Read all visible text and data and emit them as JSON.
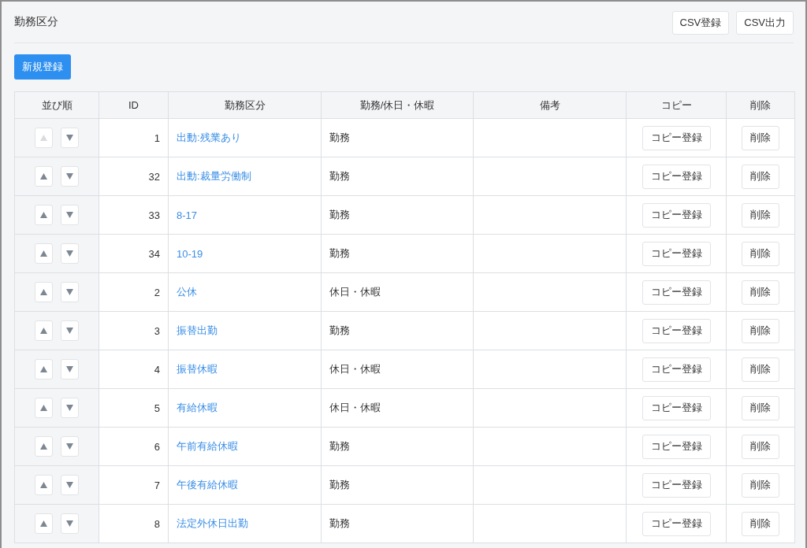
{
  "header": {
    "title": "勤務区分",
    "buttons": [
      "CSV登録",
      "CSV出力"
    ]
  },
  "new_button": "新規登録",
  "table": {
    "columns": [
      "並び順",
      "ID",
      "勤務区分",
      "勤務/休日・休暇",
      "備考",
      "コピー",
      "削除"
    ],
    "rows": [
      {
        "id": "1",
        "name": "出動:残業あり",
        "type": "勤務",
        "up_disabled": true,
        "down_disabled": false,
        "copy": "コピー登録",
        "delete": "削除"
      },
      {
        "id": "32",
        "name": "出動:裁量労働制",
        "type": "勤務",
        "up_disabled": false,
        "down_disabled": false,
        "copy": "コピー登録",
        "delete": "削除"
      },
      {
        "id": "33",
        "name": "8-17",
        "type": "勤務",
        "up_disabled": false,
        "down_disabled": false,
        "copy": "コピー登録",
        "delete": "削除"
      },
      {
        "id": "34",
        "name": "10-19",
        "type": "勤務",
        "up_disabled": false,
        "down_disabled": false,
        "copy": "コピー登録",
        "delete": "削除"
      },
      {
        "id": "2",
        "name": "公休",
        "type": "休日・休暇",
        "up_disabled": false,
        "down_disabled": false,
        "copy": "コピー登録",
        "delete": "削除"
      },
      {
        "id": "3",
        "name": "振替出勤",
        "type": "勤務",
        "up_disabled": false,
        "down_disabled": false,
        "copy": "コピー登録",
        "delete": "削除"
      },
      {
        "id": "4",
        "name": "振替休暇",
        "type": "休日・休暇",
        "up_disabled": false,
        "down_disabled": false,
        "copy": "コピー登録",
        "delete": "削除"
      },
      {
        "id": "5",
        "name": "有給休暇",
        "type": "休日・休暇",
        "up_disabled": false,
        "down_disabled": false,
        "copy": "コピー登録",
        "delete": "削除"
      },
      {
        "id": "6",
        "name": "午前有給休暇",
        "type": "勤務",
        "up_disabled": false,
        "down_disabled": false,
        "copy": "コピー登録",
        "delete": "削除"
      },
      {
        "id": "7",
        "name": "午後有給休暇",
        "type": "勤務",
        "up_disabled": false,
        "down_disabled": false,
        "copy": "コピー登録",
        "delete": "削除"
      },
      {
        "id": "8",
        "name": "法定外休日出勤",
        "type": "勤務",
        "up_disabled": false,
        "down_disabled": false,
        "copy": "コピー登録",
        "delete": "削除"
      }
    ]
  }
}
